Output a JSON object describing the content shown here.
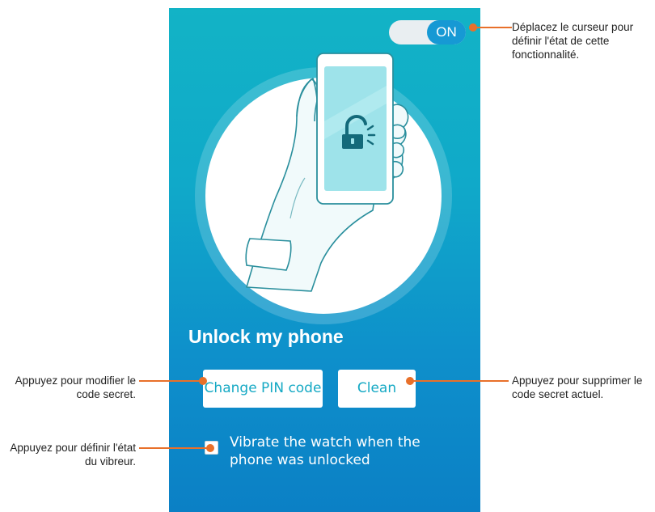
{
  "toggle": {
    "label": "ON",
    "state": "on"
  },
  "main": {
    "title": "Unlock my phone",
    "change_pin_label": "Change PIN code",
    "clean_label": "Clean",
    "vibrate_label": "Vibrate the watch when the phone was unlocked",
    "vibrate_checked": false
  },
  "callouts": {
    "toggle": "Déplacez le curseur pour définir l'état de cette fonctionnalité.",
    "change_pin": "Appuyez pour modifier le code secret.",
    "clean": "Appuyez pour supprimer le code secret actuel.",
    "vibrate": "Appuyez pour définir l'état du vibreur."
  },
  "colors": {
    "accent": "#1699d4",
    "callout_line": "#e8702a",
    "button_text": "#15a9c4",
    "background_top": "#12b3c6",
    "background_bottom": "#0b80c5"
  },
  "icons": {
    "illustration": "hand-holding-phone-illustration",
    "lock": "unlocked-padlock-icon"
  }
}
